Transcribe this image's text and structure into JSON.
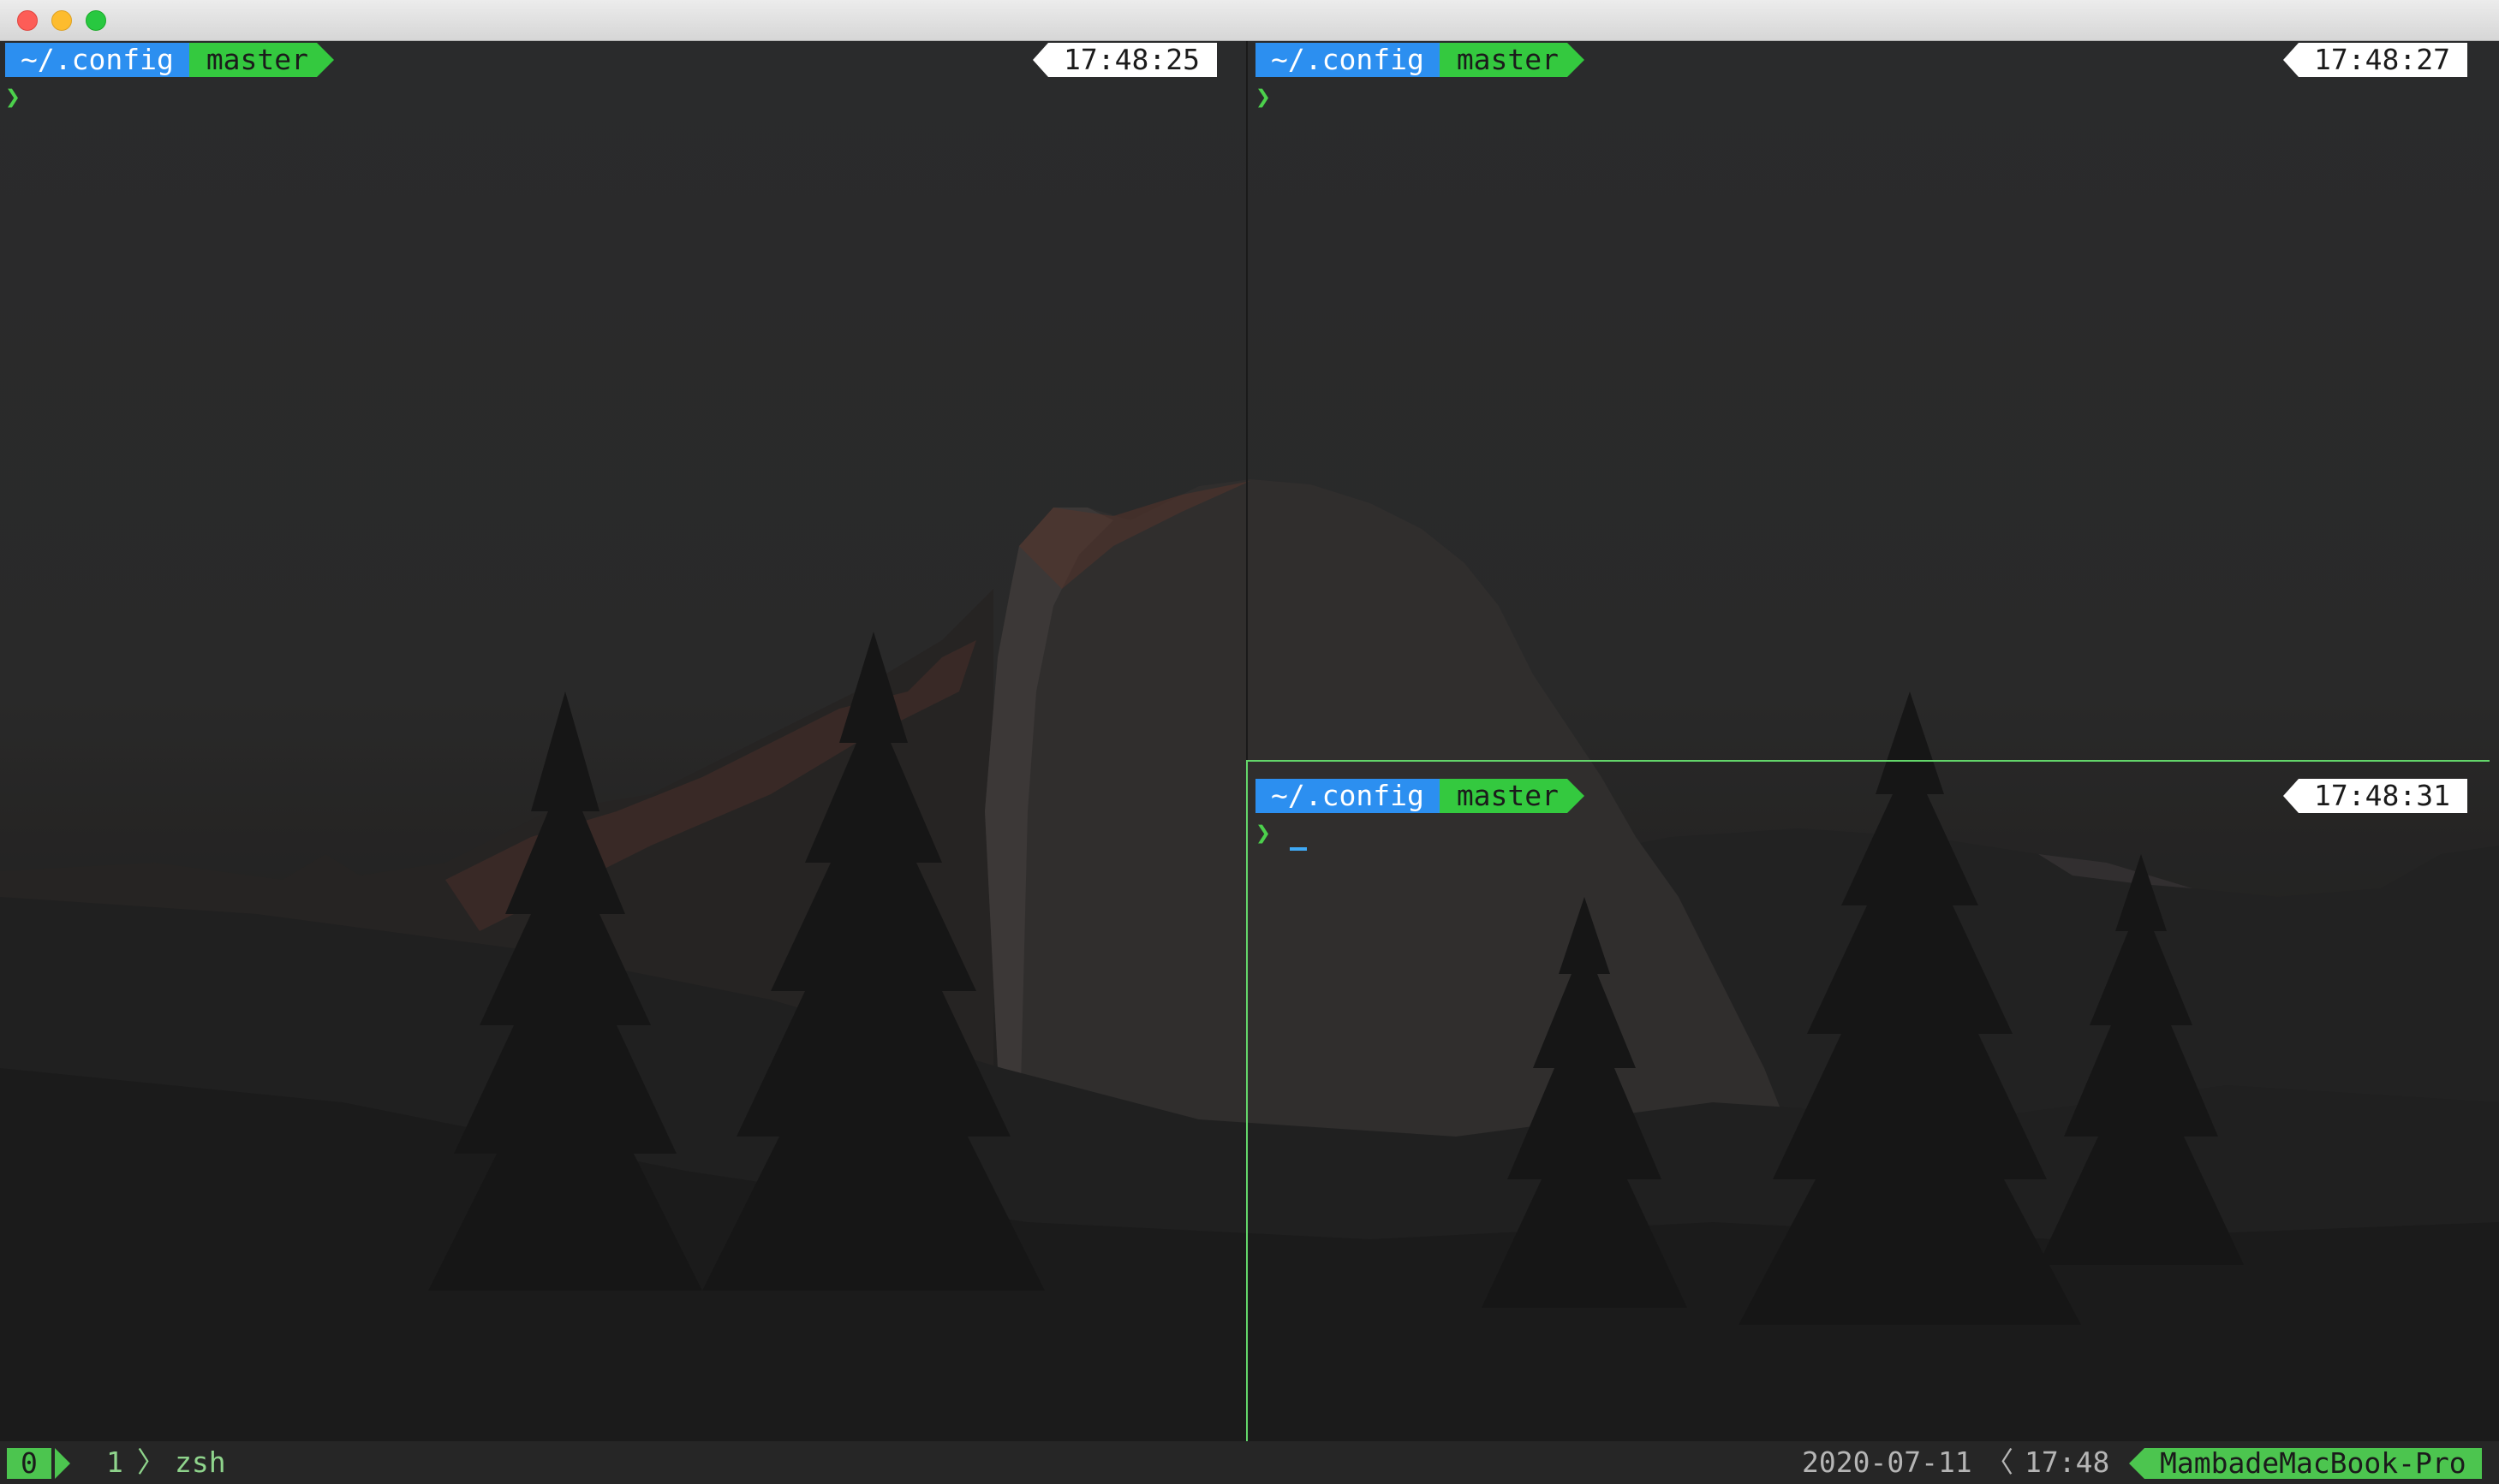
{
  "window": {
    "title_bar": {
      "buttons": [
        "close",
        "minimize",
        "maximize"
      ]
    }
  },
  "panes": [
    {
      "dir": "~/.config",
      "branch": "master",
      "time": "17:48:25",
      "prompt_symbol": "❯"
    },
    {
      "dir": "~/.config",
      "branch": "master",
      "time": "17:48:27",
      "prompt_symbol": "❯"
    },
    {
      "dir": "~/.config",
      "branch": "master",
      "time": "17:48:31",
      "prompt_symbol": "❯",
      "active": true
    }
  ],
  "status_bar": {
    "windows": [
      {
        "index": "0",
        "active": true
      },
      {
        "index": "1",
        "name": "zsh"
      }
    ],
    "date": "2020-07-11",
    "time": "17:48",
    "host": "MambadeMacBook-Pro"
  },
  "colors": {
    "dir_segment": "#2c8ff0",
    "branch_segment": "#34c93f",
    "active_border": "#63d66a",
    "cursor": "#3fa9f5"
  }
}
